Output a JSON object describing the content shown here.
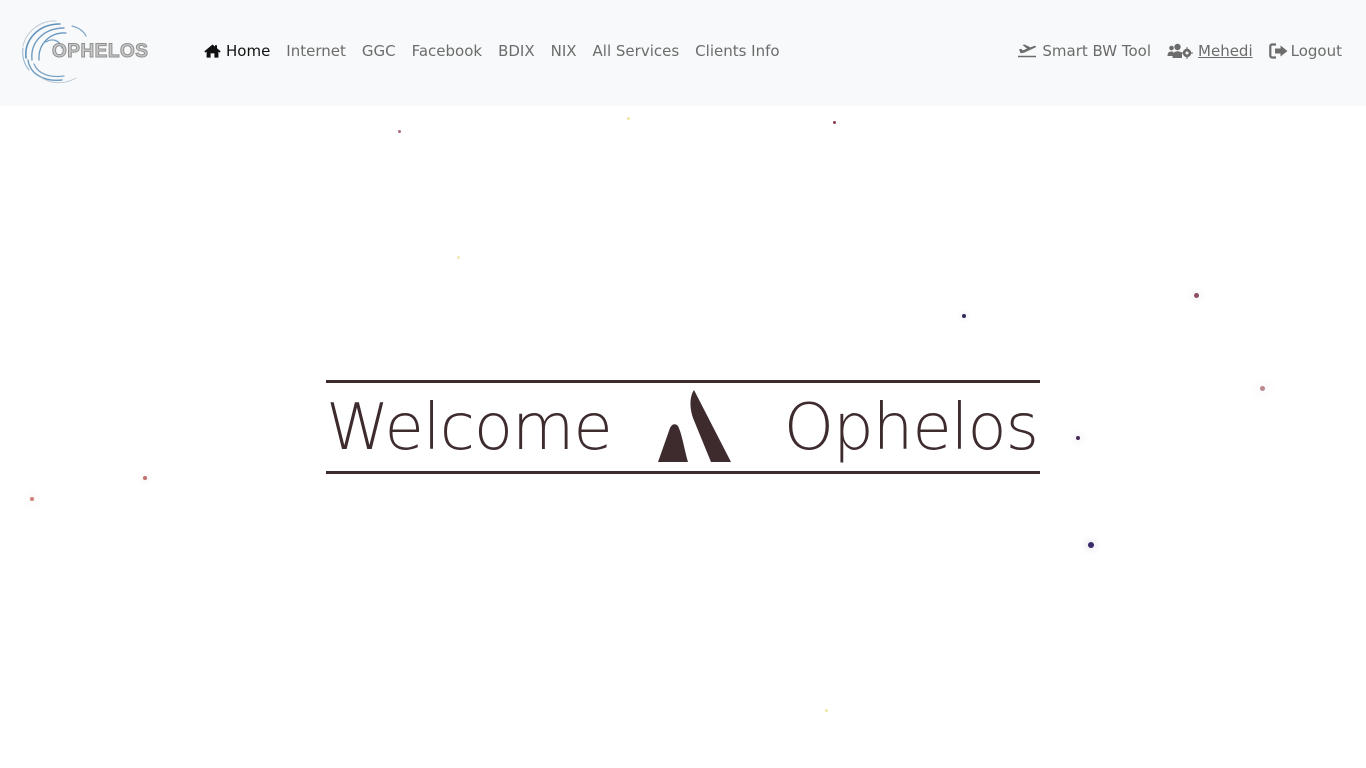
{
  "brand": {
    "name": "OPHELOS"
  },
  "nav": {
    "items": [
      {
        "label": "Home",
        "active": true,
        "icon": "home-icon"
      },
      {
        "label": "Internet"
      },
      {
        "label": "GGC"
      },
      {
        "label": "Facebook"
      },
      {
        "label": "BDIX"
      },
      {
        "label": "NIX"
      },
      {
        "label": "All Services"
      },
      {
        "label": "Clients Info"
      }
    ],
    "right": {
      "tool": {
        "label": "Smart BW Tool",
        "icon": "plane-departure-icon"
      },
      "user": {
        "label": "Mehedi",
        "icon": "users-gear-icon"
      },
      "logout": {
        "label": "Logout",
        "icon": "sign-out-icon"
      }
    }
  },
  "hero": {
    "left_word": "Welcome",
    "right_word": "Ophelos",
    "mark_icon": "atlassian-logo-icon"
  },
  "colors": {
    "nav_bg": "#f8f9fa",
    "text_dark": "#3d2b2e",
    "nav_text": "#6c6c6c"
  }
}
